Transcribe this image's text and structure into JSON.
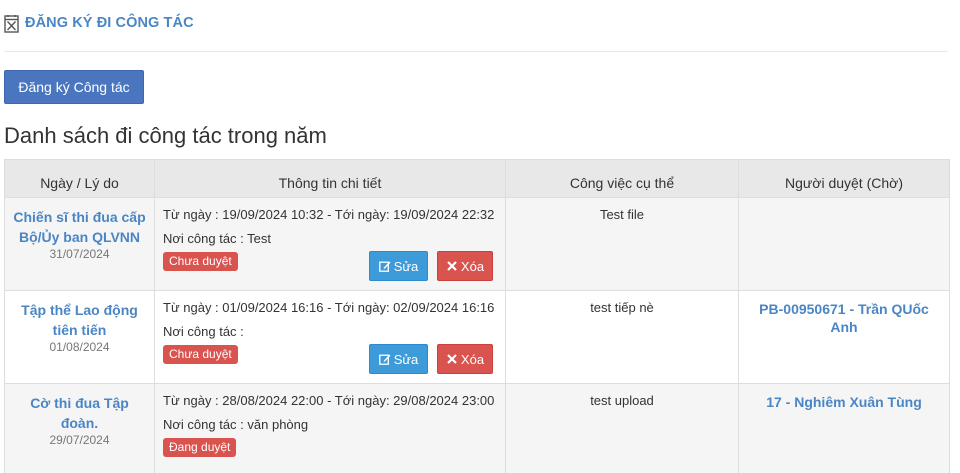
{
  "header": {
    "title": "ĐĂNG KÝ ĐI CÔNG TÁC",
    "icon": "calendar-x-icon"
  },
  "toolbar": {
    "register_label": "Đăng ký Công tác"
  },
  "section_title": "Danh sách đi công tác trong năm",
  "table": {
    "columns": [
      "Ngày / Lý do",
      "Thông tin chi tiết",
      "Công việc cụ thể",
      "Người duyệt (Chờ)"
    ],
    "rows": [
      {
        "reason": "Chiến sĩ thi đua cấp Bộ/Ủy ban QLVNN",
        "date": "31/07/2024",
        "time_range": "Từ ngày : 19/09/2024 10:32 - Tới ngày: 19/09/2024 22:32",
        "location": "Nơi công tác : Test",
        "status": "Chưa duyệt",
        "edit_label": "Sửa",
        "delete_label": "Xóa",
        "work": "Test file",
        "approver": ""
      },
      {
        "reason": "Tập thể Lao động tiên tiến",
        "date": "01/08/2024",
        "time_range": "Từ ngày : 01/09/2024 16:16 - Tới ngày: 02/09/2024 16:16",
        "location": "Nơi công tác :",
        "status": "Chưa duyệt",
        "edit_label": "Sửa",
        "delete_label": "Xóa",
        "work": "test tiếp nè",
        "approver": "PB-00950671 - Trần QUốc Anh"
      },
      {
        "reason": "Cờ thi đua Tập đoàn.",
        "date": "29/07/2024",
        "time_range": "Từ ngày : 28/08/2024 22:00 - Tới ngày: 29/08/2024 23:00",
        "location": "Nơi công tác : văn phòng",
        "status": "Đang duyệt",
        "work": "test upload",
        "approver": "17 - Nghiêm Xuân Tùng"
      }
    ]
  },
  "colors": {
    "accent": "#4a86c5",
    "primary_button": "#4a76bf",
    "edit_button": "#3e9bd9",
    "danger": "#d9534f"
  }
}
